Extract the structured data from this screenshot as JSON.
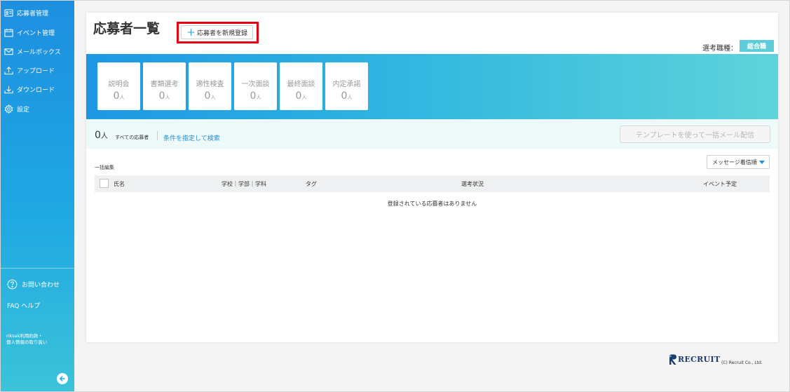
{
  "sidebar": {
    "items": [
      {
        "label": "応募者管理",
        "icon": "id-card-icon"
      },
      {
        "label": "イベント管理",
        "icon": "calendar-icon"
      },
      {
        "label": "メールボックス",
        "icon": "mail-icon"
      },
      {
        "label": "アップロード",
        "icon": "upload-icon"
      },
      {
        "label": "ダウンロード",
        "icon": "download-icon"
      },
      {
        "label": "設定",
        "icon": "gear-icon"
      }
    ],
    "help": {
      "label": "お問い合わせ",
      "icon": "question-circle-icon"
    },
    "faq": {
      "label": "FAQ ヘルプ"
    },
    "terms": {
      "line1": "riksak利用約款・",
      "line2": "個人情報の取り扱い"
    },
    "collapse_icon": "arrow-left-circle-icon"
  },
  "header": {
    "title": "応募者一覧",
    "new_button_label": "応募者を新規登録",
    "new_button_icon": "plus-icon",
    "highlight_color": "#e60012",
    "job_type_label": "選考職種：",
    "job_type_value": "総合職"
  },
  "stages": [
    {
      "label": "説明会",
      "count": "0",
      "unit": "人"
    },
    {
      "label": "書類選考",
      "count": "0",
      "unit": "人"
    },
    {
      "label": "適性検査",
      "count": "0",
      "unit": "人"
    },
    {
      "label": "一次面談",
      "count": "0",
      "unit": "人"
    },
    {
      "label": "最終面談",
      "count": "0",
      "unit": "人"
    },
    {
      "label": "内定承諾",
      "count": "0",
      "unit": "人"
    }
  ],
  "summary": {
    "count": "0",
    "unit": "人",
    "all_label": "すべての応募者",
    "search_link": "条件を指定して検索",
    "bulk_mail_button": "テンプレートを使って一括メール配信"
  },
  "table": {
    "bulk_edit_label": "一括編集",
    "sort_selected": "メッセージ着信順",
    "columns": [
      "氏名",
      "学校｜学部｜学科",
      "タグ",
      "選考状況",
      "イベント予定"
    ],
    "empty_message": "登録されている応募者はありません"
  },
  "footer": {
    "brand": "RECRUIT",
    "copyright": "(C) Recruit Co., Ltd."
  },
  "colors": {
    "sidebar_top": "#1e8fe0",
    "sidebar_bottom": "#3cc3d9",
    "accent": "#1e8fe0",
    "badge": "#5ccdd9"
  }
}
